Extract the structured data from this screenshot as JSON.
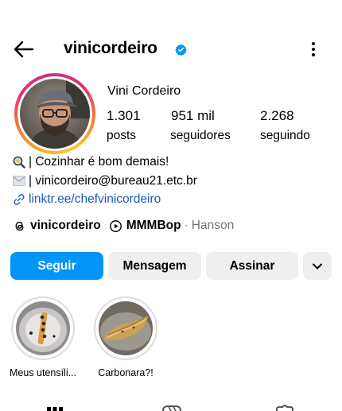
{
  "header": {
    "username": "vinicordeiro",
    "back_icon": "arrow-left-icon",
    "verified_icon": "verified-badge-icon",
    "more_icon": "more-vertical-icon"
  },
  "profile": {
    "full_name": "Vini Cordeiro",
    "stats": [
      {
        "value": "1.301",
        "label": "posts"
      },
      {
        "value": "951 mil",
        "label": "seguidores"
      },
      {
        "value": "2.268",
        "label": "seguindo"
      }
    ]
  },
  "bio": {
    "line1": "| Cozinhar é bom demais!",
    "line1_icon": "magnifier-emoji-icon",
    "line2": "| vinicordeiro@bureau21.etc.br",
    "line2_icon": "envelope-emoji-icon",
    "link": "linktr.ee/chefvinicordeiro",
    "link_icon": "link-icon"
  },
  "threads_row": {
    "threads_handle": "vinicordeiro",
    "music_title": "MMMBop",
    "music_separator": "·",
    "music_artist": "Hanson"
  },
  "actions": {
    "follow": "Seguir",
    "message": "Mensagem",
    "subscribe": "Assinar",
    "chevron_icon": "chevron-down-icon"
  },
  "highlights": [
    {
      "label": "Meus utensíli..."
    },
    {
      "label": "Carbonara?!"
    }
  ],
  "tabs": [
    {
      "icon": "grid-icon"
    },
    {
      "icon": "reels-icon"
    },
    {
      "icon": "tagged-icon"
    }
  ],
  "colors": {
    "accent": "#0095f6",
    "link": "#1a5ab8",
    "secondary_text": "#737373",
    "button_grey": "#efefef"
  }
}
